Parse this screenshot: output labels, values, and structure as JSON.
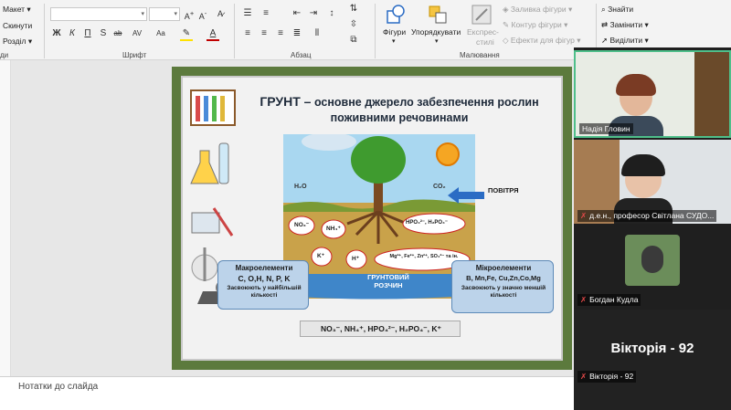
{
  "ribbon": {
    "layout_items": [
      "Макет",
      "Скинути",
      "Розділ"
    ],
    "font_group_label": "Шрифт",
    "paragraph_group_label": "Абзац",
    "drawing_group_label": "Малювання",
    "shapes_label": "Фігури",
    "arrange_label": "Упорядкувати",
    "quick_styles_label_1": "Експрес-",
    "quick_styles_label_2": "стилі",
    "shape_fill": "Заливка фігури",
    "shape_outline": "Контур фігури",
    "shape_effects": "Ефекти для фігур",
    "find": "Знайти",
    "replace": "Замінити",
    "select": "Виділити",
    "left_group_stub": "ди",
    "font_buttons": [
      "Ж",
      "К",
      "П",
      "S",
      "ab",
      "AV",
      "Aa"
    ]
  },
  "slide": {
    "title_bold": "ГРУНТ –",
    "title_rest": " основне джерело забезпечення рослин поживними речовинами",
    "air_label": "ПОВІТРЯ",
    "h2o": "H₂O",
    "co2": "CO₂",
    "no3": "NO₃⁻",
    "nh4": "NH₄⁺",
    "hpo4": "HPO₄²⁻, H₂PO₄⁻",
    "k": "K⁺",
    "h": "H⁺",
    "metals": "Mg²⁺, Fe²⁺, Zn²⁺, SO₄²⁻ та ін.",
    "solution_1": "ГРУНТОВИЙ",
    "solution_2": "РОЗЧИН",
    "macro_title": "Макроелементи",
    "macro_list": "C, O,H, N, P, K",
    "macro_note": "Засвоюють у найбільшій кількості",
    "micro_title": "Мікроелементи",
    "micro_list": "B, Mn,Fe, Cu,Zn,Co,Mg",
    "micro_note": "Засвоюють у значно меншій кількості",
    "ions_bar": "NO₃⁻, NH₄⁺, HPO₄²⁻, H₂PO₄⁻, K⁺"
  },
  "notes_placeholder": "Нотатки до слайда",
  "participants": [
    {
      "name": "Надія Гловин",
      "muted": false
    },
    {
      "name": "д.е.н., професор Світлана СУДО...",
      "muted": true
    },
    {
      "name": "Богдан Кудла",
      "muted": true
    },
    {
      "name": "Вікторія - 92",
      "muted": true,
      "big_label": "Вікторія - 92"
    }
  ],
  "colors": {
    "ribbon_bg": "#f3f3f3",
    "slide_frame": "#5c7a3d",
    "soil": "#c9a24a",
    "solution_band": "#3f86c9",
    "label_box": "#bcd3ea",
    "active_speaker_border": "#4fbf8a"
  }
}
